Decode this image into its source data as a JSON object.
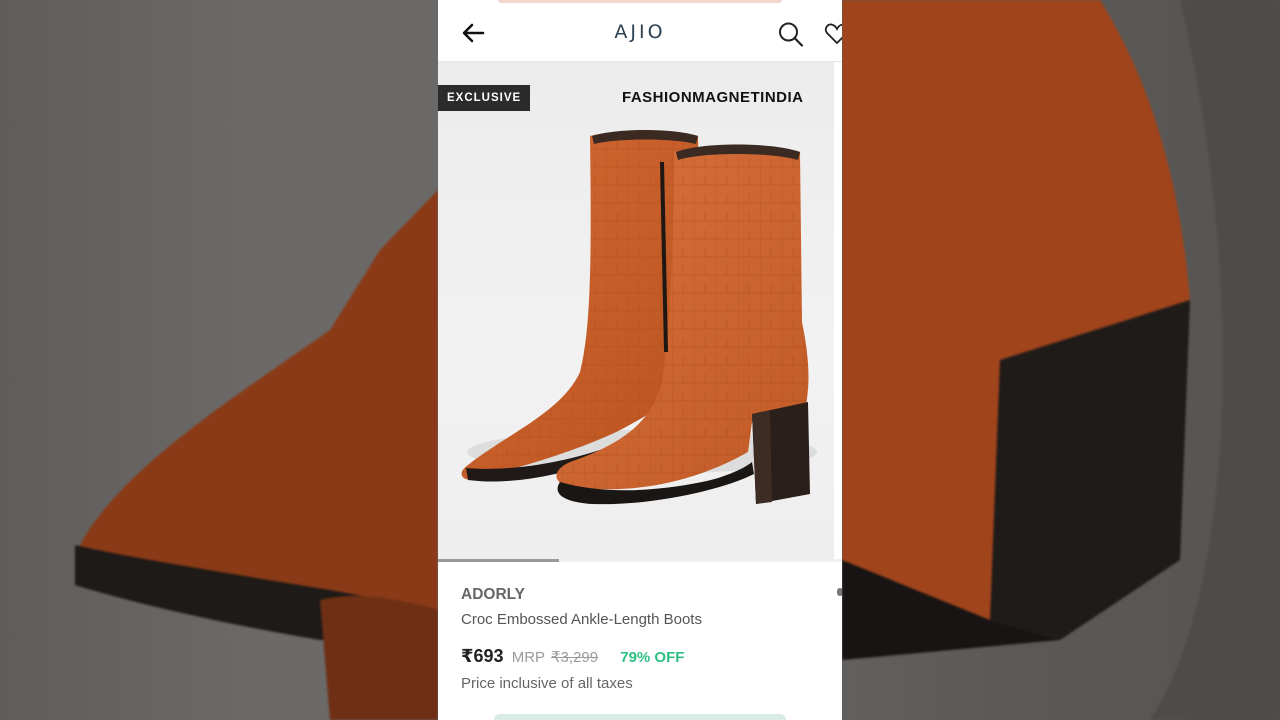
{
  "header": {
    "logo": "AJIO",
    "back_icon": "arrow-left-icon",
    "search_icon": "search-icon",
    "wishlist_icon": "heart-icon"
  },
  "gallery": {
    "badge": "EXCLUSIVE",
    "watermark": "FASHIONMAGNETINDIA",
    "image_progress": 0.3
  },
  "product": {
    "brand": "ADORLY",
    "name": "Croc Embossed Ankle-Length Boots",
    "price": "₹693",
    "mrp_label": "MRP",
    "mrp": "₹3,299",
    "discount": "79% OFF",
    "tax_note": "Price inclusive of all taxes"
  },
  "colors": {
    "accent_discount": "#2fbf84",
    "logo": "#2c4152",
    "boot": "#c45a2a"
  }
}
